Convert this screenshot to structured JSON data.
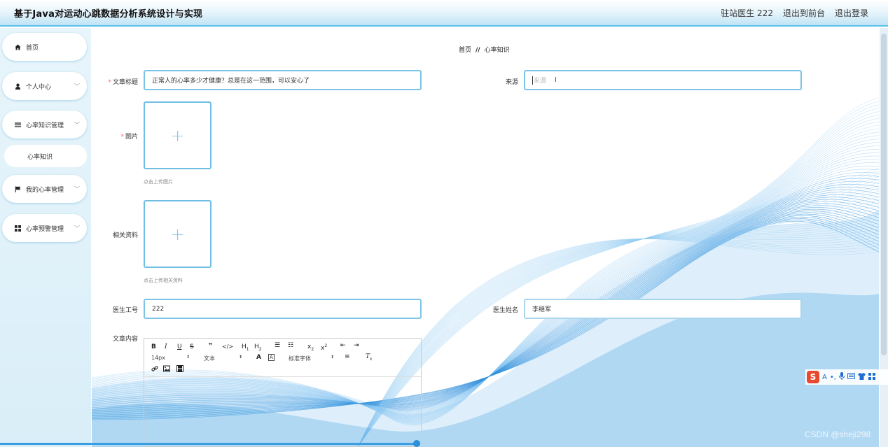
{
  "header": {
    "title": "基于Java对运动心跳数据分析系统设计与实现",
    "user_label": "驻站医生 222",
    "back_to_front": "退出到前台",
    "logout": "退出登录"
  },
  "sidebar": {
    "items": [
      {
        "label": "首页",
        "icon": "home-icon"
      },
      {
        "label": "个人中心",
        "icon": "user-icon"
      },
      {
        "label": "心率知识管理",
        "icon": "list-icon"
      },
      {
        "label": "我的心率管理",
        "icon": "flag-icon"
      },
      {
        "label": "心率预警管理",
        "icon": "grid-icon"
      }
    ],
    "submenu": {
      "label": "心率知识"
    }
  },
  "breadcrumb": {
    "home": "首页",
    "separator": "//",
    "current": "心率知识"
  },
  "form": {
    "title_label": "文章标题",
    "title_value": "正常人的心率多少才健康？总是在这一范围，可以安心了",
    "source_label": "来源",
    "source_placeholder": "来源",
    "image_label": "图片",
    "image_hint": "点击上传图片",
    "attachment_label": "相关资料",
    "attachment_hint": "点击上传相关资料",
    "doctor_id_label": "医生工号",
    "doctor_id_value": "222",
    "doctor_name_label": "医生姓名",
    "doctor_name_value": "李继军",
    "content_label": "文章内容",
    "upload_plus": "+"
  },
  "editor": {
    "font_size": "14px",
    "paragraph": "文本",
    "font_family": "标准字体",
    "buttons": [
      "B",
      "I",
      "U",
      "S",
      "❞",
      "</>",
      "H1",
      "H2",
      "ordered-list",
      "bullet-list",
      "x2-sub",
      "x2-sup",
      "outdent",
      "indent",
      "A",
      "background-color",
      "align",
      "clean",
      "link",
      "image",
      "video"
    ]
  },
  "ime": {
    "logo": "S",
    "glyphs": [
      "A",
      "•,",
      "🎤",
      "⌨",
      "👕",
      "▦"
    ]
  },
  "watermark": "CSDN @sheji298",
  "colors": {
    "accent": "#5cc0ea",
    "input_border": "#7cc5e6",
    "required": "#f56c6c",
    "wave": "#3a9ee0"
  }
}
